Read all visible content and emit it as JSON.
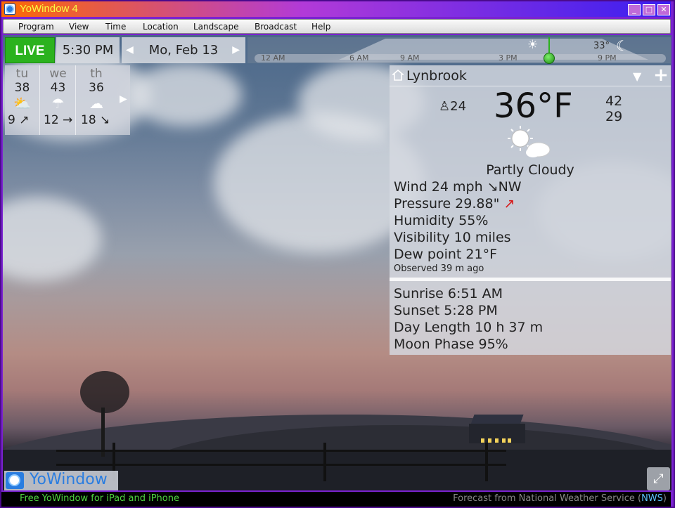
{
  "window": {
    "title": "YoWindow 4",
    "min": "_",
    "max": "□",
    "close": "✕"
  },
  "menu": [
    "Program",
    "View",
    "Time",
    "Location",
    "Landscape",
    "Broadcast",
    "Help"
  ],
  "controls": {
    "live": "LIVE",
    "time": "5:30 PM",
    "date": "Mo, Feb 13",
    "prev": "◀",
    "next": "▶"
  },
  "timeline": {
    "ticks": [
      "12 AM",
      "6 AM",
      "9 AM",
      "3 PM",
      "9 PM"
    ],
    "temp": "33°"
  },
  "forecast": {
    "days": [
      {
        "name": "tu",
        "hi": "38",
        "icon": "sun-cloud-icon",
        "wind": "9 ↗"
      },
      {
        "name": "we",
        "hi": "43",
        "icon": "rain-cloud-icon",
        "wind": "12 →"
      },
      {
        "name": "th",
        "hi": "36",
        "icon": "cloud-icon",
        "wind": "18 ↘"
      }
    ],
    "next": "▶"
  },
  "weather": {
    "location": "Lynbrook",
    "feels": "24",
    "temp": "36°F",
    "high": "42",
    "low": "29",
    "condition": "Partly Cloudy",
    "wind": "Wind  24 mph  ↘NW",
    "pressure": "Pressure  29.88\"",
    "pressure_arrow": "↗",
    "humidity": "Humidity  55%",
    "visibility": "Visibility  10 miles",
    "dewpoint": "Dew point  21°F",
    "observed": "Observed 39 m ago",
    "sunrise": "Sunrise  6:51 AM",
    "sunset": "Sunset  5:28 PM",
    "daylength": "Day Length  10 h 37 m",
    "moon": "Moon Phase  95%"
  },
  "brand": {
    "name": "YoWindow"
  },
  "status": {
    "promo": "Free YoWindow for iPad and iPhone",
    "source_prefix": "Forecast from National Weather Service (",
    "source_link": "NWS",
    "source_suffix": ")"
  }
}
